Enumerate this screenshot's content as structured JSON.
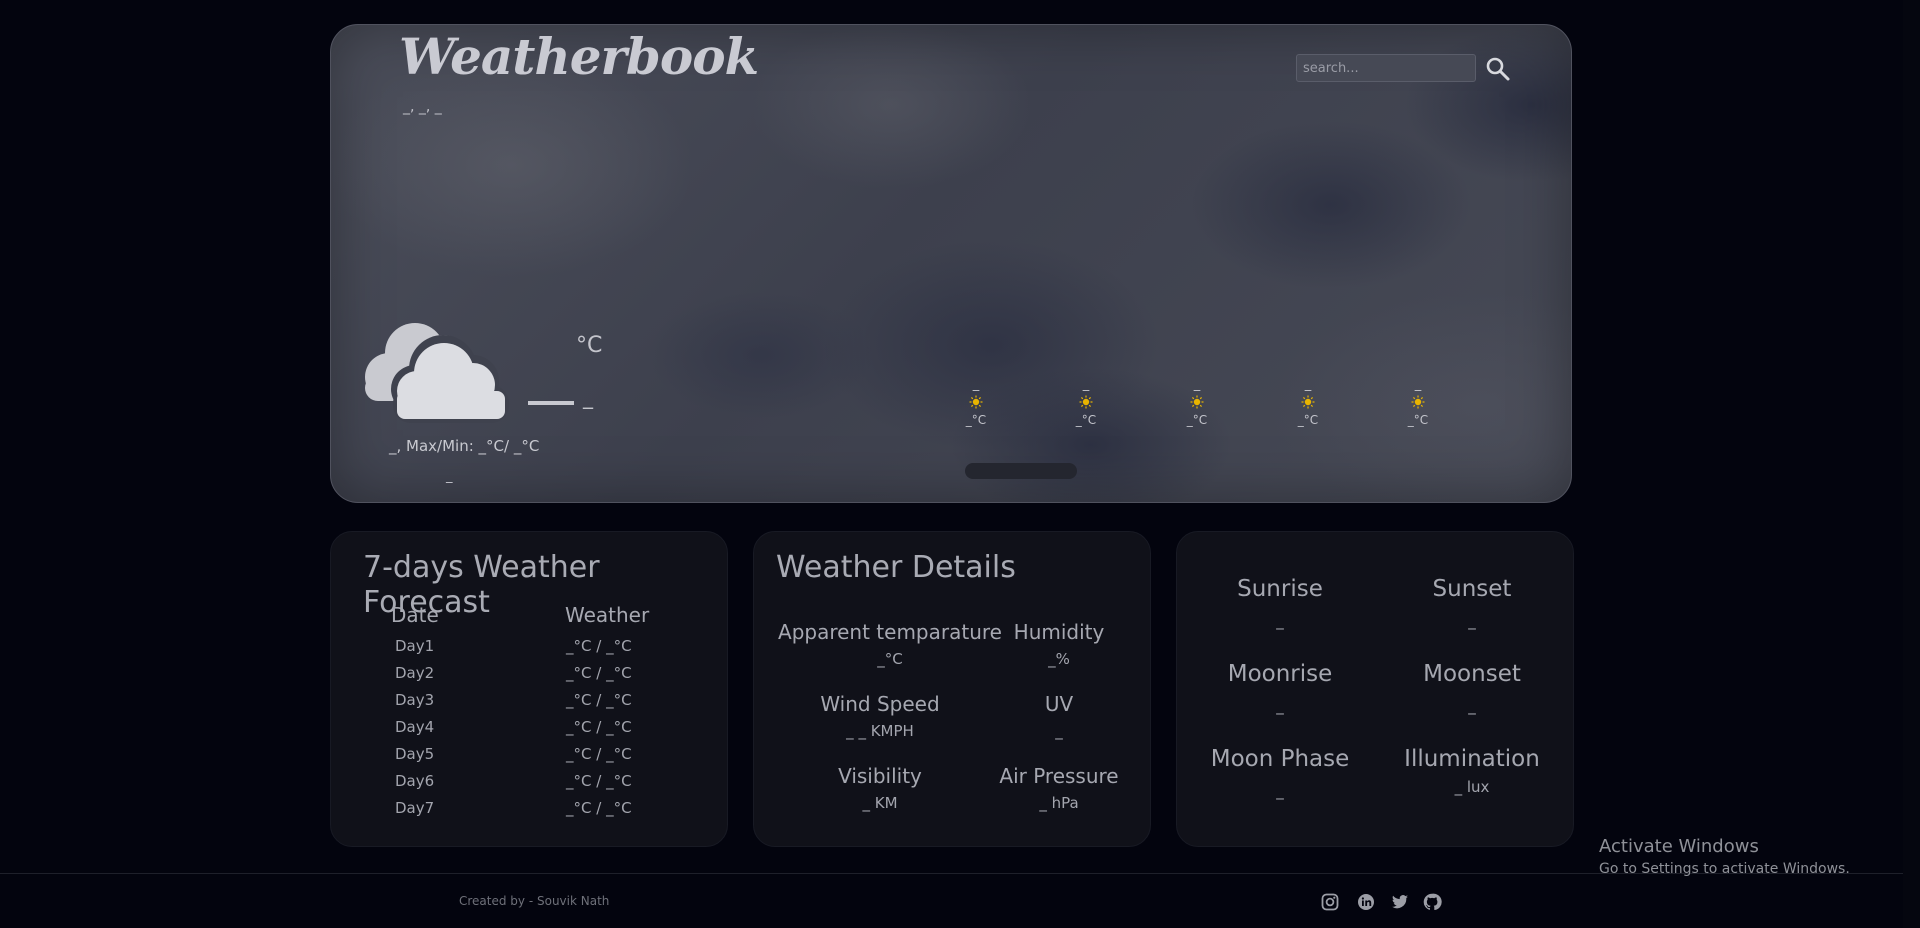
{
  "header": {
    "brand": "Weatherbook",
    "date_line": "_, _, _",
    "search_placeholder": "search..."
  },
  "current": {
    "unit": "°C",
    "temp": "_",
    "condition_line": "_, Max/Min: _°C/ _°C",
    "sub_line": "_",
    "icon": "cloud-icon"
  },
  "hourly": [
    {
      "time": "_",
      "temp": "_°C",
      "icon": "sun-icon"
    },
    {
      "time": "_",
      "temp": "_°C",
      "icon": "sun-icon"
    },
    {
      "time": "_",
      "temp": "_°C",
      "icon": "sun-icon"
    },
    {
      "time": "_",
      "temp": "_°C",
      "icon": "sun-icon"
    },
    {
      "time": "_",
      "temp": "_°C",
      "icon": "sun-icon"
    }
  ],
  "forecast": {
    "title": "7-days Weather Forecast",
    "col_date": "Date",
    "col_weather": "Weather",
    "rows": [
      {
        "day": "Day1",
        "weather": "_°C / _°C"
      },
      {
        "day": "Day2",
        "weather": "_°C / _°C"
      },
      {
        "day": "Day3",
        "weather": "_°C / _°C"
      },
      {
        "day": "Day4",
        "weather": "_°C / _°C"
      },
      {
        "day": "Day5",
        "weather": "_°C / _°C"
      },
      {
        "day": "Day6",
        "weather": "_°C / _°C"
      },
      {
        "day": "Day7",
        "weather": "_°C / _°C"
      }
    ]
  },
  "details": {
    "title": "Weather Details",
    "items": [
      {
        "label": "Apparent temparature",
        "value": "_°C"
      },
      {
        "label": "Humidity",
        "value": "_%"
      },
      {
        "label": "Wind Speed",
        "value": "_ _ KMPH"
      },
      {
        "label": "UV",
        "value": "_"
      },
      {
        "label": "Visibility",
        "value": "_ KM"
      },
      {
        "label": "Air Pressure",
        "value": "_ hPa"
      }
    ]
  },
  "astro": {
    "items": [
      {
        "label": "Sunrise",
        "value": "_"
      },
      {
        "label": "Sunset",
        "value": "_"
      },
      {
        "label": "Moonrise",
        "value": "_"
      },
      {
        "label": "Moonset",
        "value": "_"
      },
      {
        "label": "Moon Phase",
        "value": "_"
      },
      {
        "label": "Illumination",
        "value": "_ lux"
      }
    ]
  },
  "footer": {
    "credit": "Created by - Souvik Nath",
    "social_icons": [
      "instagram-icon",
      "linkedin-icon",
      "twitter-icon",
      "github-icon"
    ]
  },
  "os_overlay": {
    "title": "Activate Windows",
    "subtitle": "Go to Settings to activate Windows."
  },
  "colors": {
    "background": "#03040e",
    "card": "#101119",
    "sun": "#e8b400"
  }
}
